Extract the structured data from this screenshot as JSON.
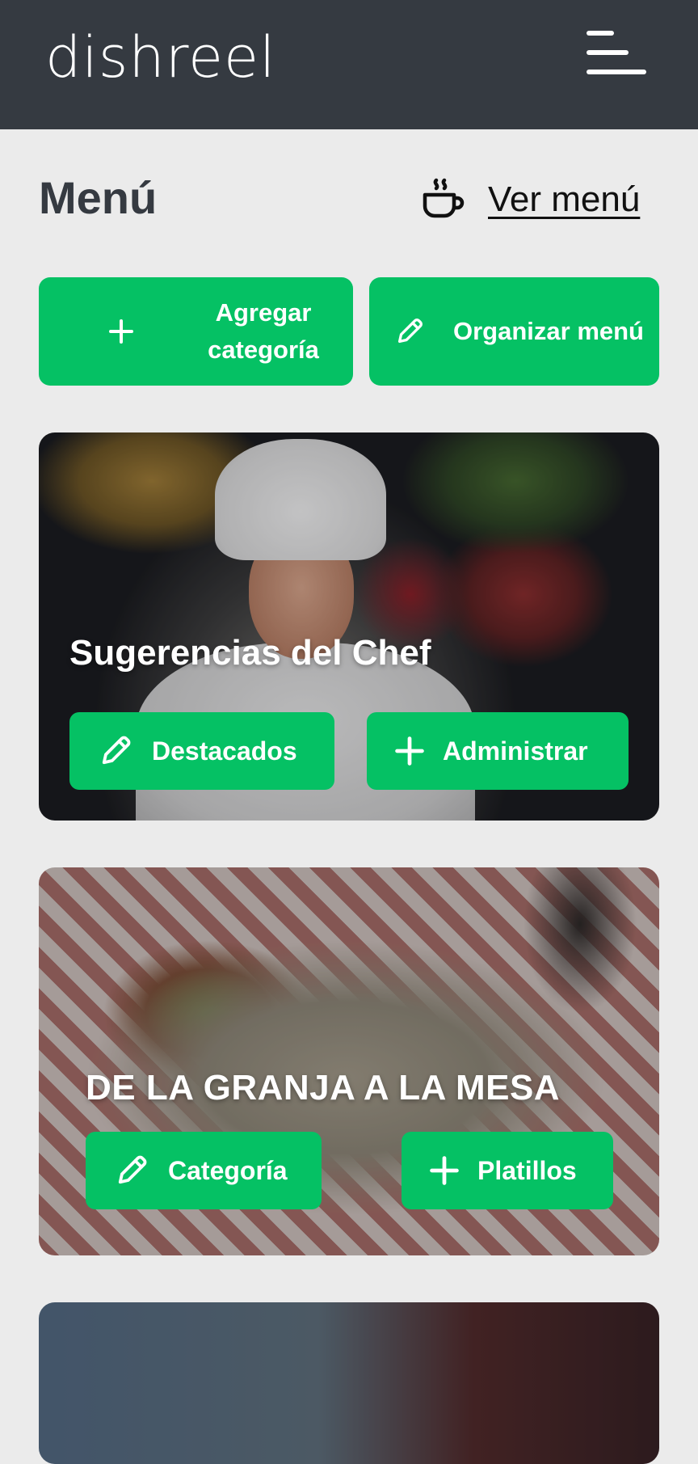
{
  "header": {
    "logo_text": "dishreel",
    "menu_icon": "hamburger-menu-icon"
  },
  "page": {
    "title": "Menú",
    "view_menu_icon": "coffee-cup-icon",
    "view_menu_label": "Ver menú"
  },
  "actions": {
    "add_category_icon": "plus-icon",
    "add_category_label": "Agregar categoría",
    "organize_icon": "pencil-icon",
    "organize_label": "Organizar menú"
  },
  "categories": [
    {
      "title": "Sugerencias del Chef",
      "buttons": [
        {
          "icon": "pencil-icon",
          "label": "Destacados"
        },
        {
          "icon": "plus-icon",
          "label": "Administrar"
        }
      ]
    },
    {
      "title": "DE LA GRANJA A LA MESA",
      "buttons": [
        {
          "icon": "pencil-icon",
          "label": "Categoría"
        },
        {
          "icon": "plus-icon",
          "label": "Platillos"
        }
      ]
    }
  ],
  "colors": {
    "header_bg": "#353a41",
    "accent_green": "#05c164",
    "page_bg": "#ebebeb"
  }
}
